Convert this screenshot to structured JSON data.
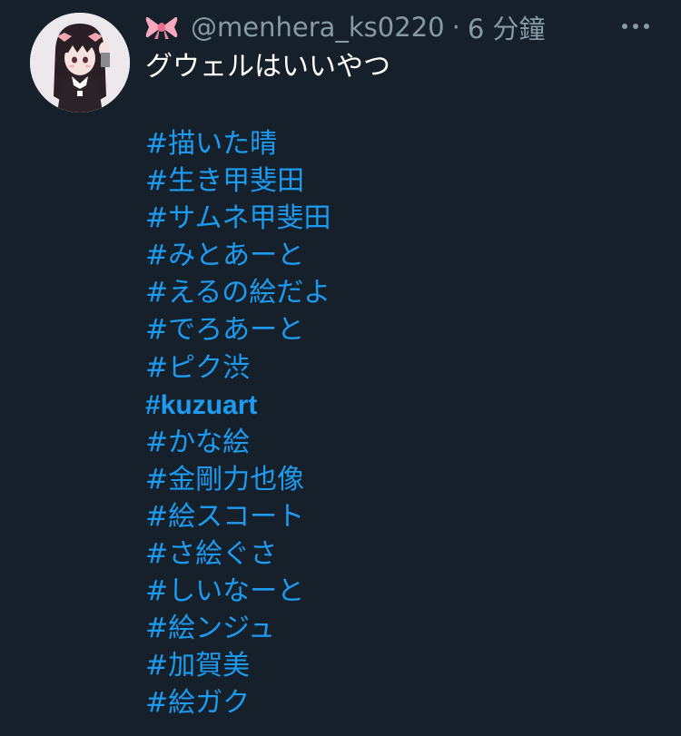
{
  "tweet": {
    "display_emoji_icon": "ribbon-icon",
    "handle": "@menhera_ks0220",
    "separator": "·",
    "timestamp": "6 分鐘",
    "more_icon": "more-horizontal-icon",
    "text": "グウェルはいいやつ",
    "hashtags": [
      "#描いた晴",
      "#生き甲斐田",
      "#サムネ甲斐田",
      "#みとあーと",
      "#えるの絵だよ",
      "#でろあーと",
      "#ピク渋",
      "#kuzuart",
      "#かな絵",
      "#金剛力也像",
      "#絵スコート",
      "#さ絵ぐさ",
      "#しいなーと",
      "#絵ンジュ",
      "#加賀美",
      "#絵ガク"
    ]
  },
  "colors": {
    "background": "#15202b",
    "text_primary": "#ffffff",
    "text_secondary": "#8899a6",
    "link": "#1d9bf0"
  }
}
